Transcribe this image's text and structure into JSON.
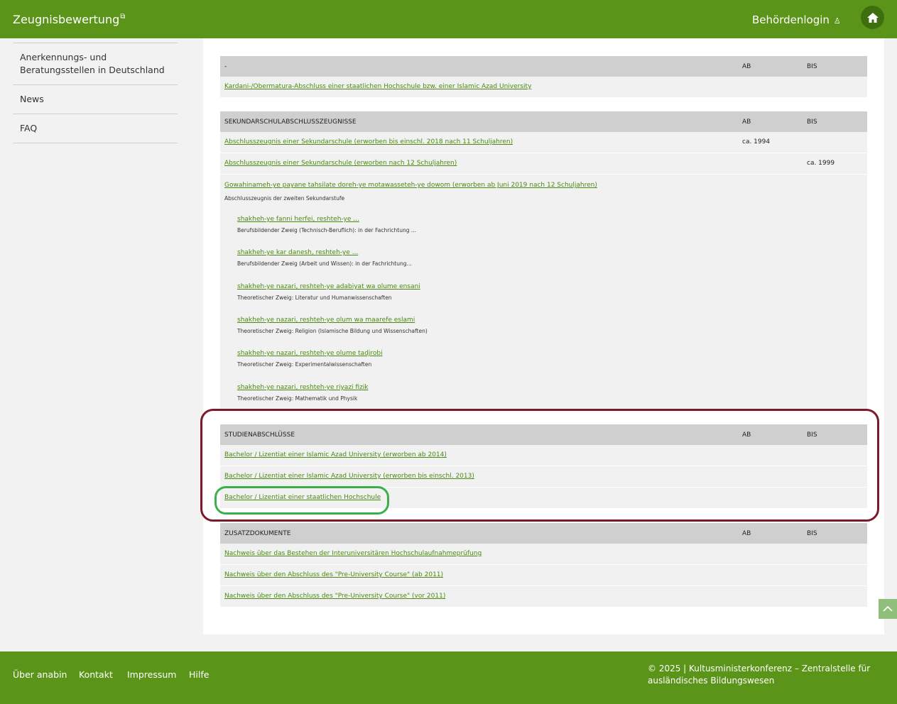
{
  "header": {
    "brand": "Zeugnisbewertung",
    "brand_ext_icon": "external-link-icon",
    "login": "Behördenlogin",
    "login_icon": "user-icon",
    "home_icon": "home-icon"
  },
  "sidebar": {
    "items": [
      {
        "label": "Anerkennungs- und Beratungsstellen in Deutschland"
      },
      {
        "label": "News"
      },
      {
        "label": "FAQ"
      }
    ]
  },
  "tables": {
    "t1": {
      "header": {
        "title": "-",
        "ab": "AB",
        "bis": "BIS"
      },
      "rows": [
        {
          "label": "Kardani-/Obermatura-Abschluss einer staatlichen Hochschule bzw. einer Islamic Azad University",
          "ab": "",
          "bis": ""
        }
      ]
    },
    "t2": {
      "header": {
        "title": "SEKUNDARSCHULABSCHLUSSZEUGNISSE",
        "ab": "AB",
        "bis": "BIS"
      },
      "rows": [
        {
          "label": "Abschlusszeugnis einer Sekundarschule (erworben bis einschl. 2018 nach 11 Schuljahren)",
          "ab": "ca. 1994",
          "bis": ""
        },
        {
          "label": "Abschlusszeugnis einer Sekundarschule (erworben nach 12 Schuljahren)",
          "ab": "",
          "bis": "ca. 1999"
        }
      ],
      "block": {
        "label": "Gowahinameh-ye payane tahsilate doreh-ye motawasseteh-ye dowom (erworben ab Juni 2019 nach 12 Schuljahren)",
        "desc": "Abschlusszeugnis der zweiten Sekundarstufe",
        "subs": [
          {
            "label": "shakheh-ye fanni herfei, reshteh-ye ...",
            "desc": "Berufsbildender Zweig (Technisch-Beruflich): in der Fachrichtung ..."
          },
          {
            "label": "shakheh-ye kar danesh, reshteh-ye ...",
            "desc": "Berufsbildender Zweig (Arbeit und Wissen): in der Fachrichtung..."
          },
          {
            "label": "shakheh-ye nazari, reshteh-ye adabiyat wa olume ensani",
            "desc": "Theoretischer Zweig: Literatur und Humanwissenschaften"
          },
          {
            "label": "shakheh-ye nazari, reshteh-ye olum wa maarefe eslami",
            "desc": "Theoretischer Zweig: Religion (Islamische Bildung und Wissenschaften)"
          },
          {
            "label": "shakheh-ye nazari, reshteh-ye olume tadjrobi",
            "desc": "Theoretischer Zweig: Experimentalwissenschaften"
          },
          {
            "label": "shakheh-ye nazari, reshteh-ye riyazi fizik",
            "desc": "Theoretischer Zweig: Mathematik und Physik"
          }
        ]
      }
    },
    "t3": {
      "header": {
        "title": "STUDIENABSCHLÜSSE",
        "ab": "AB",
        "bis": "BIS"
      },
      "rows": [
        {
          "label": "Bachelor / Lizentiat einer Islamic Azad University (erworben ab 2014)",
          "ab": "",
          "bis": ""
        },
        {
          "label": "Bachelor / Lizentiat einer Islamic Azad University (erworben bis einschl. 2013)",
          "ab": "",
          "bis": ""
        },
        {
          "label": "Bachelor / Lizentiat einer staatlichen Hochschule",
          "ab": "",
          "bis": ""
        }
      ]
    },
    "t4": {
      "header": {
        "title": "ZUSATZDOKUMENTE",
        "ab": "AB",
        "bis": "BIS"
      },
      "rows": [
        {
          "label": "Nachweis über das Bestehen der Interuniversitären Hochschulaufnahmeprüfung",
          "ab": "",
          "bis": ""
        },
        {
          "label": "Nachweis über den Abschluss des \"Pre-University Course\" (ab 2011)",
          "ab": "",
          "bis": ""
        },
        {
          "label": "Nachweis über den Abschluss des \"Pre-University Course\" (vor 2011)",
          "ab": "",
          "bis": ""
        }
      ]
    }
  },
  "footer": {
    "links": [
      "Über anabin",
      "Kontakt",
      "Impressum",
      "Hilfe"
    ],
    "copyright": "© 2025 | Kultusministerkonferenz – Zentralstelle für ausländisches Bildungswesen"
  },
  "colors": {
    "brand_green": "#5a9418",
    "link_green": "#4a8a10",
    "highlight_red": "#7d1a2a",
    "highlight_green": "#3bb04a"
  }
}
